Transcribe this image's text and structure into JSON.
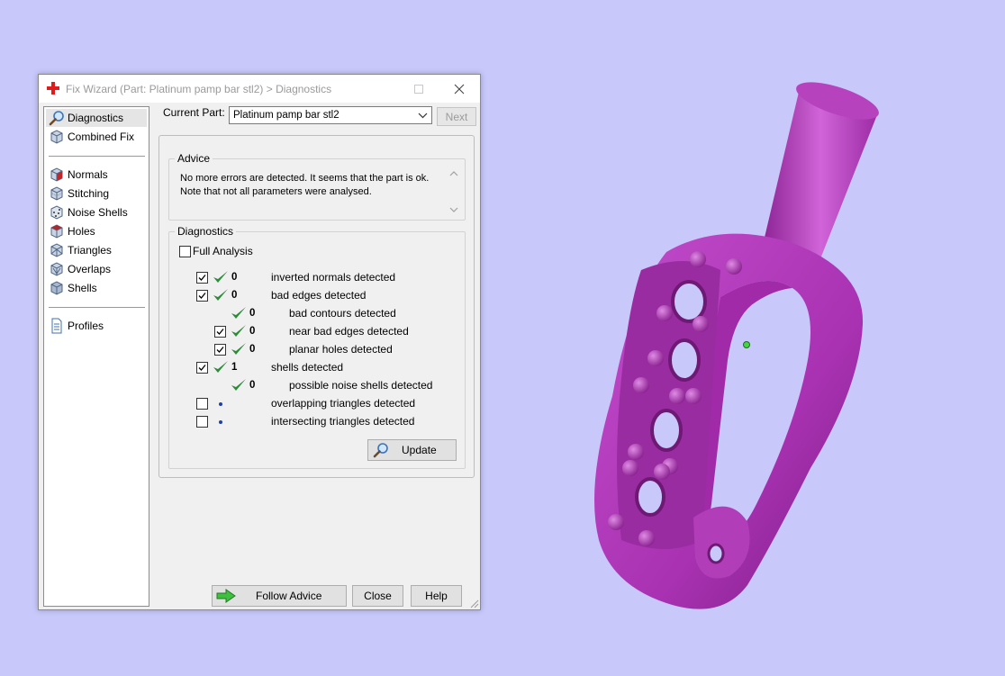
{
  "window": {
    "title": "Fix Wizard (Part: Platinum pamp bar stl2) > Diagnostics"
  },
  "nav": {
    "items": [
      {
        "label": "Diagnostics",
        "icon": "magnifier-icon"
      },
      {
        "label": "Combined Fix",
        "icon": "cube-icon"
      },
      {
        "label": "Normals",
        "icon": "cube-red-face-icon"
      },
      {
        "label": "Stitching",
        "icon": "cube-stitch-icon"
      },
      {
        "label": "Noise Shells",
        "icon": "cube-noise-icon"
      },
      {
        "label": "Holes",
        "icon": "cube-holes-icon"
      },
      {
        "label": "Triangles",
        "icon": "cube-triangle-icon"
      },
      {
        "label": "Overlaps",
        "icon": "cube-overlap-icon"
      },
      {
        "label": "Shells",
        "icon": "cube-shells-icon"
      },
      {
        "label": "Profiles",
        "icon": "document-icon"
      }
    ],
    "selected": "Diagnostics"
  },
  "current_part": {
    "label": "Current Part:",
    "value": "Platinum pamp bar stl2",
    "next_label": "Next"
  },
  "advice": {
    "title": "Advice",
    "text_line1": "No more errors are detected. It seems that the part is ok.",
    "text_line2": "Note that not all parameters were analysed."
  },
  "diagnostics": {
    "title": "Diagnostics",
    "full_analysis_label": "Full Analysis",
    "full_analysis_checked": false,
    "rows": [
      {
        "checkbox": true,
        "checked": true,
        "status": "ok",
        "count": "0",
        "label": "inverted normals detected"
      },
      {
        "checkbox": true,
        "checked": true,
        "status": "ok",
        "count": "0",
        "label": "bad edges detected"
      },
      {
        "checkbox": false,
        "checked": false,
        "status": "ok",
        "count": "0",
        "label": "bad contours detected"
      },
      {
        "checkbox": true,
        "checked": true,
        "status": "ok",
        "count": "0",
        "label": "near bad edges detected"
      },
      {
        "checkbox": true,
        "checked": true,
        "status": "ok",
        "count": "0",
        "label": "planar holes detected"
      },
      {
        "checkbox": true,
        "checked": true,
        "status": "ok",
        "count": "1",
        "label": "shells detected"
      },
      {
        "checkbox": false,
        "checked": false,
        "status": "ok",
        "count": "0",
        "label": "possible noise shells detected"
      },
      {
        "checkbox": true,
        "checked": false,
        "status": "pending",
        "count": "",
        "label": "overlapping triangles detected"
      },
      {
        "checkbox": true,
        "checked": false,
        "status": "pending",
        "count": "",
        "label": "intersecting triangles detected"
      }
    ],
    "update_label": "Update"
  },
  "footer": {
    "follow_advice_label": "Follow Advice",
    "close_label": "Close",
    "help_label": "Help"
  },
  "colors": {
    "background": "#c8c8fb",
    "model": "#b13db9",
    "check_green": "#2e8b3a"
  }
}
